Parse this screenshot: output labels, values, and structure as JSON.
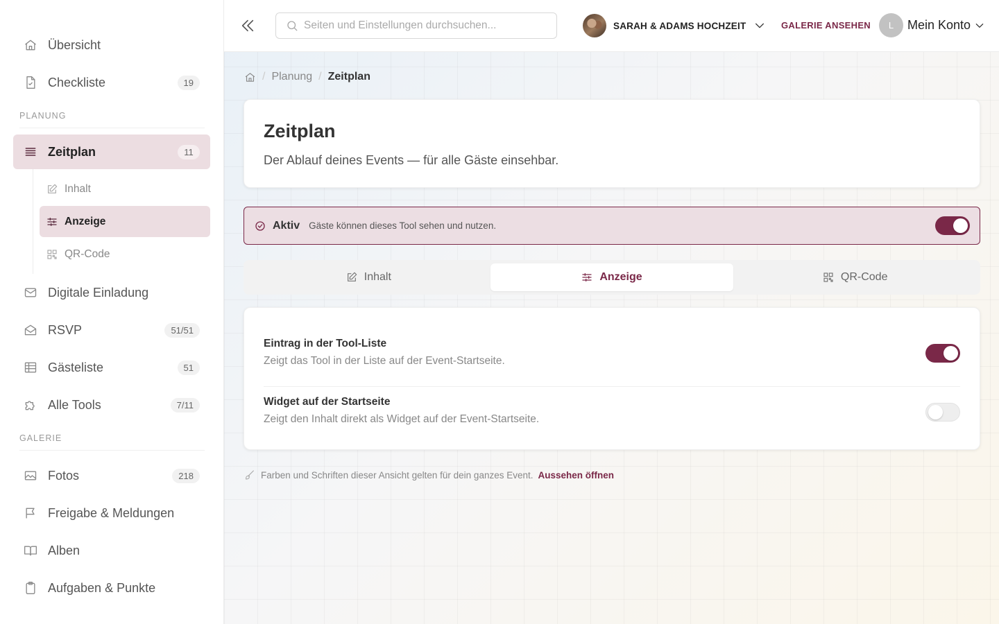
{
  "sidebar": {
    "items_top": [
      {
        "label": "Übersicht",
        "badge": ""
      },
      {
        "label": "Checkliste",
        "badge": "19"
      }
    ],
    "section_planung": "PLANUNG",
    "zeitplan": {
      "label": "Zeitplan",
      "badge": "11"
    },
    "sub_items": [
      {
        "label": "Inhalt"
      },
      {
        "label": "Anzeige"
      },
      {
        "label": "QR-Code"
      }
    ],
    "items_planung": [
      {
        "label": "Digitale Einladung",
        "badge": ""
      },
      {
        "label": "RSVP",
        "badge": "51/51"
      },
      {
        "label": "Gästeliste",
        "badge": "51"
      },
      {
        "label": "Alle Tools",
        "badge": "7/11"
      }
    ],
    "section_galerie": "GALERIE",
    "items_galerie": [
      {
        "label": "Fotos",
        "badge": "218"
      },
      {
        "label": "Freigabe & Meldungen",
        "badge": ""
      },
      {
        "label": "Alben",
        "badge": ""
      },
      {
        "label": "Aufgaben & Punkte",
        "badge": ""
      }
    ]
  },
  "topbar": {
    "search_placeholder": "Seiten und Einstellungen durchsuchen...",
    "event_name": "SARAH & ADAMS HOCHZEIT",
    "gallery_link": "GALERIE ANSEHEN",
    "account_initial": "L",
    "account_label": "Mein Konto"
  },
  "breadcrumb": {
    "parent": "Planung",
    "current": "Zeitplan"
  },
  "header": {
    "title": "Zeitplan",
    "subtitle": "Der Ablauf deines Events — für alle Gäste einsehbar."
  },
  "status": {
    "label": "Aktiv",
    "text": "Gäste können dieses Tool sehen und nutzen.",
    "enabled": true
  },
  "tabs": [
    {
      "label": "Inhalt",
      "active": false
    },
    {
      "label": "Anzeige",
      "active": true
    },
    {
      "label": "QR-Code",
      "active": false
    }
  ],
  "settings": [
    {
      "title": "Eintrag in der Tool-Liste",
      "description": "Zeigt das Tool in der Liste auf der Event-Startseite.",
      "enabled": true
    },
    {
      "title": "Widget auf der Startseite",
      "description": "Zeigt den Inhalt direkt als Widget auf der Event-Startseite.",
      "enabled": false
    }
  ],
  "footer": {
    "note": "Farben und Schriften dieser Ansicht gelten für dein ganzes Event.",
    "link": "Aussehen öffnen"
  },
  "colors": {
    "accent": "#7a2848",
    "active_bg": "#ecdde1"
  }
}
